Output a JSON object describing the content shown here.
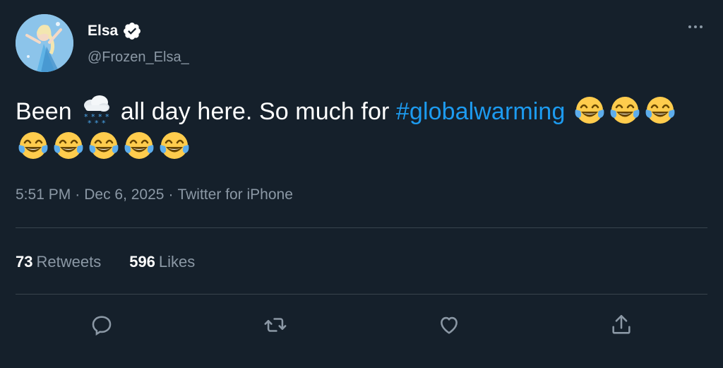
{
  "author": {
    "display_name": "Elsa",
    "handle": "@Frozen_Elsa_",
    "verified": true
  },
  "tweet": {
    "text_part1": "Been",
    "emoji_cloud": "cloud-with-snow",
    "text_part2": "all day here. So much for",
    "hashtag": "#globalwarming",
    "emoji_laugh": "face-with-tears-of-joy",
    "laugh_count": 8
  },
  "meta": {
    "time": "5:51 PM",
    "separator": "·",
    "date": "Dec 6, 2025",
    "source": "Twitter for iPhone"
  },
  "stats": {
    "retweets_count": "73",
    "retweets_label": "Retweets",
    "likes_count": "596",
    "likes_label": "Likes"
  },
  "actions": [
    "reply-icon",
    "retweet-icon",
    "like-icon",
    "share-icon"
  ],
  "colors": {
    "background": "#15202b",
    "text_primary": "#ffffff",
    "text_secondary": "#8b98a5",
    "hashtag": "#1d9bf0",
    "divider": "#38444d"
  }
}
